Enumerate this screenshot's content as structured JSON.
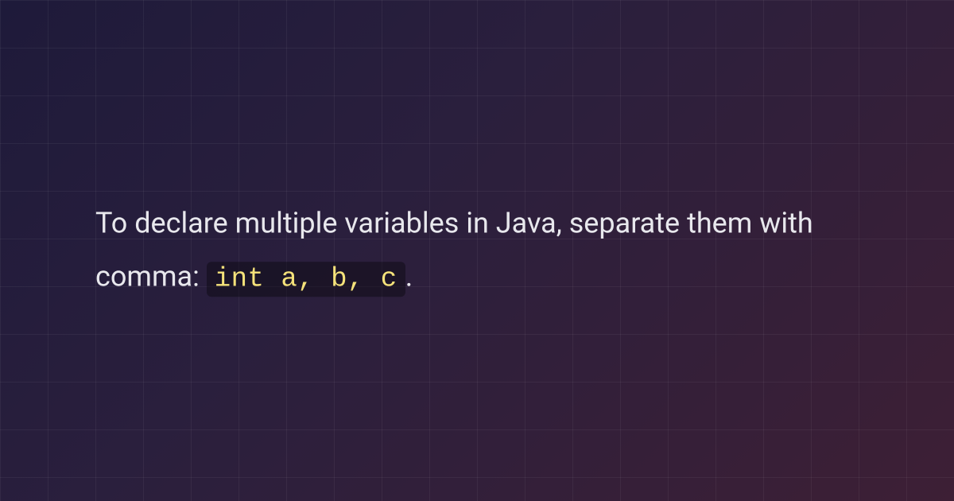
{
  "content": {
    "text_before": "To declare multiple variables in Java, separate them with comma: ",
    "code": "int a, b, c",
    "text_after": "."
  }
}
